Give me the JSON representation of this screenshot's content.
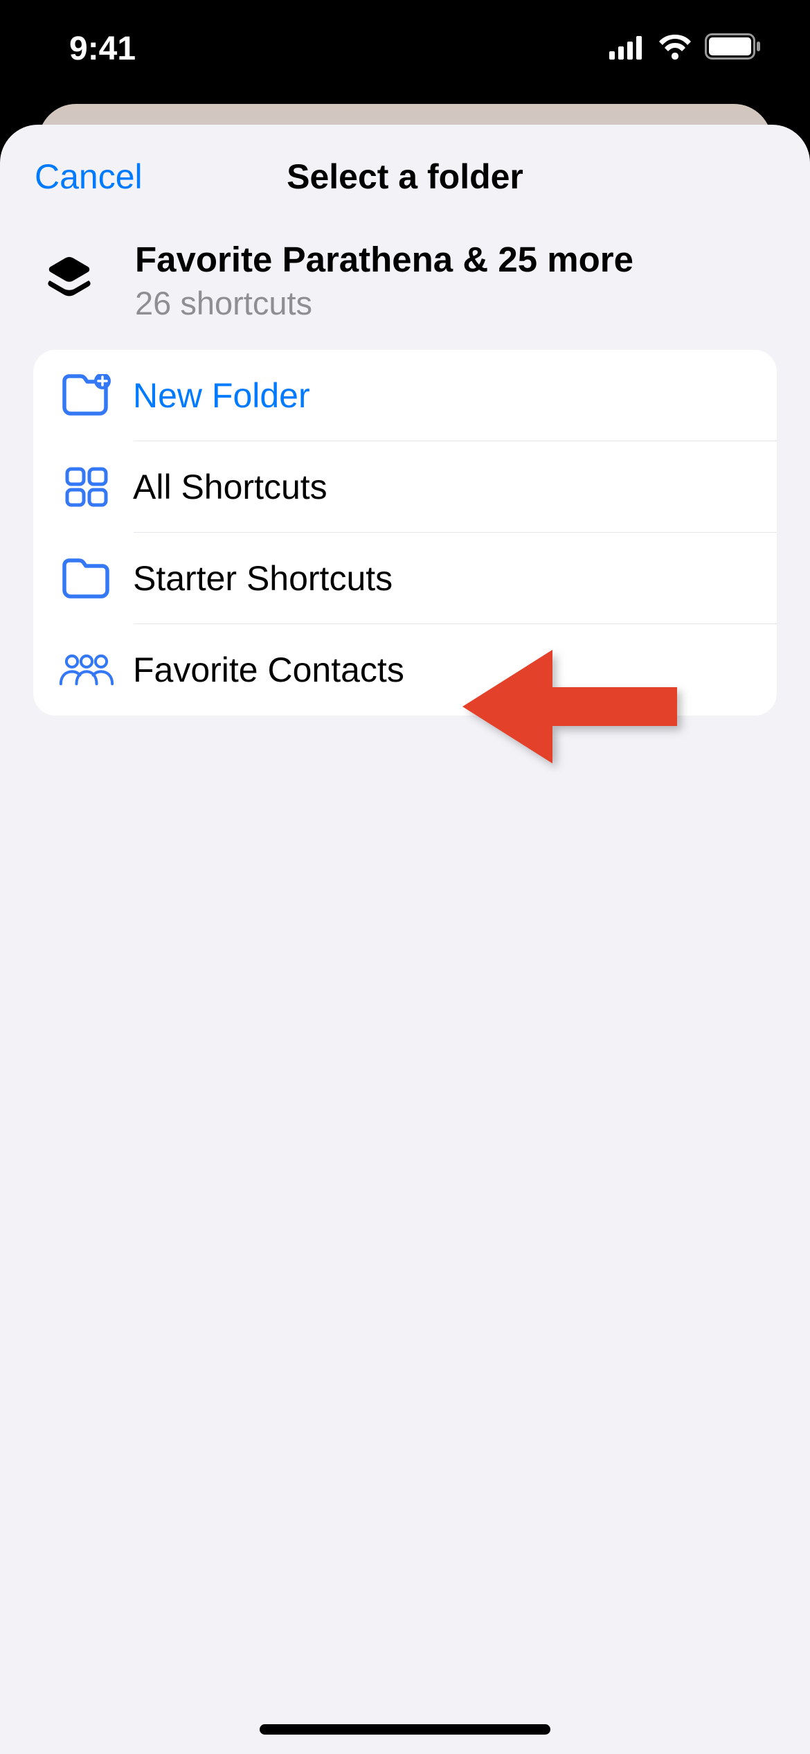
{
  "status": {
    "time": "9:41"
  },
  "nav": {
    "cancel": "Cancel",
    "title": "Select a folder"
  },
  "selection": {
    "title": "Favorite Parathena & 25 more",
    "subtitle": "26 shortcuts"
  },
  "rows": {
    "new_folder": "New Folder",
    "all_shortcuts": "All Shortcuts",
    "starter_shortcuts": "Starter Shortcuts",
    "favorite_contacts": "Favorite Contacts"
  },
  "colors": {
    "accent": "#007aff",
    "annotation": "#e4412b"
  }
}
